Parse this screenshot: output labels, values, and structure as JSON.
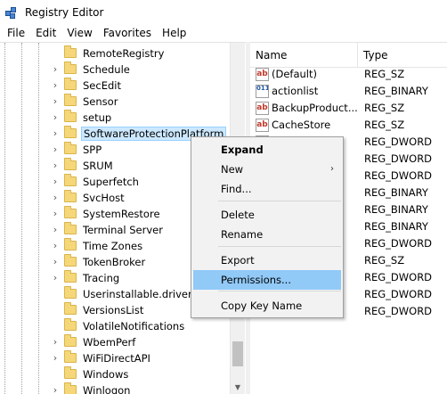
{
  "window": {
    "title": "Registry Editor",
    "icon": "regedit-icon"
  },
  "menubar": [
    "File",
    "Edit",
    "View",
    "Favorites",
    "Help"
  ],
  "tree": {
    "items": [
      {
        "label": "RemoteRegistry",
        "expandable": false
      },
      {
        "label": "Schedule",
        "expandable": true
      },
      {
        "label": "SecEdit",
        "expandable": true
      },
      {
        "label": "Sensor",
        "expandable": true
      },
      {
        "label": "setup",
        "expandable": true
      },
      {
        "label": "SoftwareProtectionPlatform",
        "expandable": true,
        "selected": true
      },
      {
        "label": "SPP",
        "expandable": true
      },
      {
        "label": "SRUM",
        "expandable": true
      },
      {
        "label": "Superfetch",
        "expandable": true
      },
      {
        "label": "SvcHost",
        "expandable": true
      },
      {
        "label": "SystemRestore",
        "expandable": true
      },
      {
        "label": "Terminal Server",
        "expandable": true
      },
      {
        "label": "Time Zones",
        "expandable": true
      },
      {
        "label": "TokenBroker",
        "expandable": true
      },
      {
        "label": "Tracing",
        "expandable": true
      },
      {
        "label": "Userinstallable.drivers",
        "expandable": false
      },
      {
        "label": "VersionsList",
        "expandable": false
      },
      {
        "label": "VolatileNotifications",
        "expandable": false
      },
      {
        "label": "WbemPerf",
        "expandable": true
      },
      {
        "label": "WiFiDirectAPI",
        "expandable": true
      },
      {
        "label": "Windows",
        "expandable": false
      },
      {
        "label": "Winlogon",
        "expandable": true
      }
    ]
  },
  "list": {
    "columns": {
      "name": "Name",
      "type": "Type"
    },
    "rows": [
      {
        "name": "(Default)",
        "type": "REG_SZ",
        "kind": "sz"
      },
      {
        "name": "actionlist",
        "type": "REG_BINARY",
        "kind": "bin"
      },
      {
        "name": "BackupProduct...",
        "type": "REG_SZ",
        "kind": "sz"
      },
      {
        "name": "CacheStore",
        "type": "REG_SZ",
        "kind": "sz"
      },
      {
        "name": "",
        "type": "REG_DWORD",
        "kind": "bin"
      },
      {
        "name": "",
        "type": "REG_DWORD",
        "kind": "bin"
      },
      {
        "name": "",
        "type": "REG_DWORD",
        "kind": "bin"
      },
      {
        "name": "",
        "type": "REG_BINARY",
        "kind": "bin"
      },
      {
        "name": "ay",
        "type": "REG_BINARY",
        "kind": "bin"
      },
      {
        "name": "d",
        "type": "REG_BINARY",
        "kind": "bin"
      },
      {
        "name": "",
        "type": "REG_DWORD",
        "kind": "bin"
      },
      {
        "name": "",
        "type": "REG_SZ",
        "kind": "sz"
      },
      {
        "name": "",
        "type": "REG_DWORD",
        "kind": "bin"
      },
      {
        "name": "",
        "type": "REG_DWORD",
        "kind": "bin"
      },
      {
        "name": "val",
        "type": "REG_DWORD",
        "kind": "bin"
      }
    ]
  },
  "context_menu": {
    "items": [
      {
        "label": "Expand",
        "bold": true,
        "name": "ctx-expand"
      },
      {
        "label": "New",
        "submenu": true,
        "name": "ctx-new"
      },
      {
        "label": "Find...",
        "name": "ctx-find"
      },
      {
        "label": "Delete",
        "name": "ctx-delete"
      },
      {
        "label": "Rename",
        "name": "ctx-rename"
      },
      {
        "label": "Export",
        "name": "ctx-export"
      },
      {
        "label": "Permissions...",
        "highlight": true,
        "name": "ctx-permissions"
      },
      {
        "label": "Copy Key Name",
        "name": "ctx-copy-key-name"
      }
    ]
  },
  "colors": {
    "selection": "#cce8ff",
    "menu_highlight": "#91c9f7",
    "folder": "#f5d77a"
  }
}
